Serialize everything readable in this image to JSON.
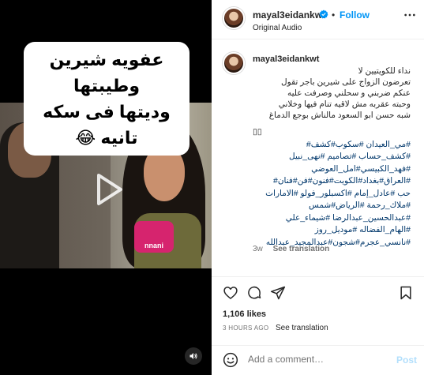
{
  "post": {
    "username": "mayal3eidankwt",
    "follow_label": "Follow",
    "separator": "•",
    "audio_label": "Original Audio",
    "video_caption_line1": "عفويه شيرين وطيبتها",
    "video_caption_line2": "وديتها فى سكه تانيه 😂",
    "mic_brand": "nnani"
  },
  "caption": {
    "username": "mayal3eidankwt",
    "lines": [
      "نداء للكويتيين لا",
      "تعرضون الزواج على شيرين باجر تقول",
      "عنكم ضربني و سحلني وصرفت عليه",
      "وحبته عقربه مش لاقيه تنام فيها وخلاني",
      "شبه حسن ابو السعود مالناش بوجع الدماغ"
    ],
    "box_glyphs": "▯▯",
    "hashtags": [
      "#مي_العيدان #سكوب#كشف#",
      "#كشف_حساب #تصاميم #نهى_نبيل",
      "#فهد_الكبيسي#امل_العوضي",
      "#العراق#بغداد#الكويت#فنون#فن#فنان#",
      "حب #عادل_إمام #اكسبلور_فولو #الامارات",
      "#ملاك_رحمة #الرياض#شمس",
      "#عبدالحسين_عبدالرضا #شيماء_علي",
      "#الهام_الفضاله #موديل_روز",
      "#نانسي_عجرم#شجون#عبدالمجيد_عبدالله"
    ],
    "age": "3w",
    "see_translation": "See translation"
  },
  "stats": {
    "likes": "1,106 likes",
    "time_ago": "3 HOURS AGO",
    "see_translation": "See translation"
  },
  "comment_box": {
    "placeholder": "Add a comment…",
    "post_label": "Post"
  },
  "icons": {
    "play": "play-icon",
    "sound": "speaker-icon",
    "verified": "verified-badge-icon",
    "more": "more-options-icon",
    "like": "heart-icon",
    "comment": "comment-icon",
    "share": "paper-plane-icon",
    "save": "bookmark-icon",
    "emoji": "emoji-icon"
  },
  "colors": {
    "link_blue": "#0095f6",
    "hashtag_blue": "#00376b",
    "muted": "#737373",
    "post_disabled": "#b2dffc"
  }
}
